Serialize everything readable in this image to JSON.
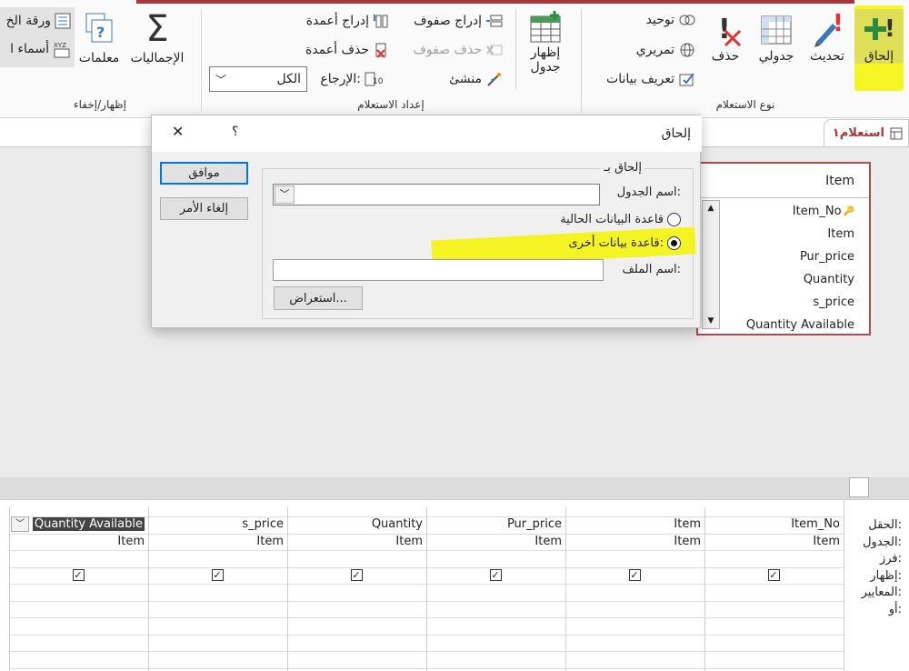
{
  "ribbon": {
    "groups": {
      "show_hide": "إظهار/إخفاء",
      "query_setup": "إعداد الاستعلام",
      "query_type": "نوع الاستعلام"
    },
    "show_hide": {
      "property_sheet": "ورقة الخ",
      "table_names": "أسماء ا"
    },
    "parameters": "معلمات",
    "totals": "الإجماليات",
    "insert_columns": "إدراج أعمدة",
    "delete_columns": "حذف أعمدة",
    "return_label": "الإرجاع:",
    "return_value": "الكل",
    "insert_rows": "إدراج صفوف",
    "delete_rows": "حذف صفوف",
    "builder": "منشئ",
    "show_table": [
      "إظهار",
      "جدول"
    ],
    "union": "توحيد",
    "pass_through": "تمريري",
    "data_definition": "تعريف بيانات",
    "delete": "حذف",
    "crosstab": "جدولي",
    "update": "تحديث",
    "append": "إلحاق"
  },
  "tab": {
    "query_name": "استعلام١"
  },
  "table_box": {
    "title": "Item",
    "fields": [
      "Item_No",
      "Item",
      "Pur_price",
      "Quantity",
      "s_price",
      "Quantity Available"
    ]
  },
  "dialog": {
    "title": "إلحاق",
    "help": "؟",
    "close": "✕",
    "ok": "موافق",
    "cancel": "إلغاء الأمر",
    "group_label": "إلحاق بـ",
    "table_name_label": "اسم الجدول:",
    "table_name_value": "",
    "current_db": "قاعدة البيانات الحالية",
    "another_db": "قاعدة بيانات أخرى:",
    "file_name_label": "اسم الملف:",
    "file_name_value": "",
    "browse": "استعراض..."
  },
  "grid": {
    "row_labels": [
      "الحقل:",
      "الجدول:",
      "فرز:",
      "إظهار:",
      "المعايير:",
      "أو:"
    ],
    "columns": [
      {
        "field": "Item_No",
        "table": "Item",
        "show": true
      },
      {
        "field": "Item",
        "table": "Item",
        "show": true
      },
      {
        "field": "Pur_price",
        "table": "Item",
        "show": true
      },
      {
        "field": "Quantity",
        "table": "Item",
        "show": true
      },
      {
        "field": "s_price",
        "table": "Item",
        "show": true
      },
      {
        "field": "Quantity Available",
        "table": "Item",
        "show": true
      }
    ]
  },
  "colors": {
    "accent": "#a4373a",
    "highlight": "#f5f500"
  }
}
